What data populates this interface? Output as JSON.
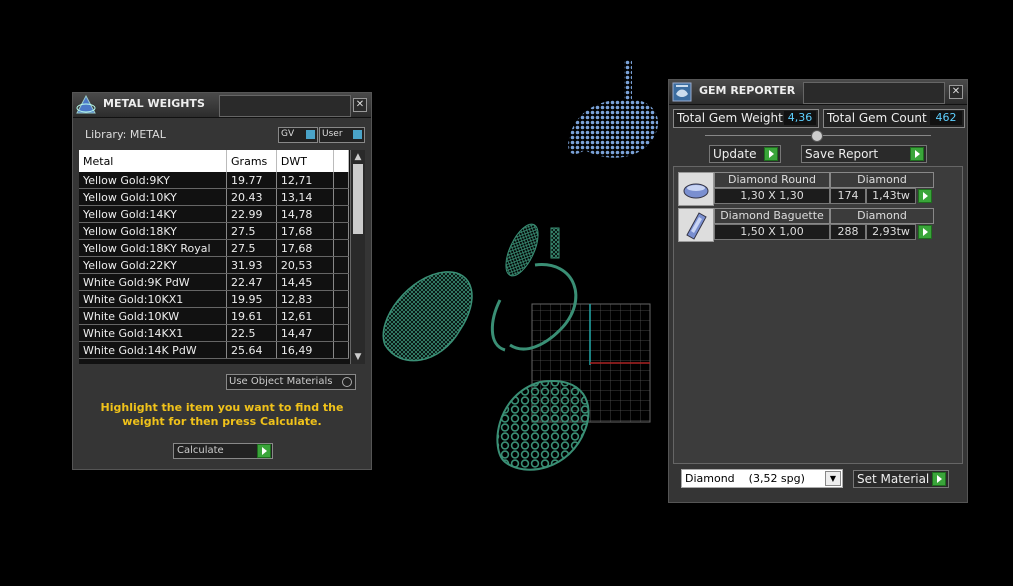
{
  "metal_weights": {
    "title": "METAL WEIGHTS",
    "library_label": "Library: METAL",
    "gv_label": "GV",
    "user_label": "User",
    "columns": [
      "Metal",
      "Grams",
      "DWT"
    ],
    "rows": [
      [
        "Yellow Gold:9KY",
        "19.77",
        "12,71"
      ],
      [
        "Yellow Gold:10KY",
        "20.43",
        "13,14"
      ],
      [
        "Yellow Gold:14KY",
        "22.99",
        "14,78"
      ],
      [
        "Yellow Gold:18KY",
        "27.5",
        "17,68"
      ],
      [
        "Yellow Gold:18KY Royal",
        "27.5",
        "17,68"
      ],
      [
        "Yellow Gold:22KY",
        "31.93",
        "20,53"
      ],
      [
        "White Gold:9K PdW",
        "22.47",
        "14,45"
      ],
      [
        "White Gold:10KX1",
        "19.95",
        "12,83"
      ],
      [
        "White Gold:10KW",
        "19.61",
        "12,61"
      ],
      [
        "White Gold:14KX1",
        "22.5",
        "14,47"
      ],
      [
        "White Gold:14K PdW",
        "25.64",
        "16,49"
      ]
    ],
    "use_object_materials": "Use Object Materials",
    "instruction": "Highlight the item you want to find the weight for then press Calculate.",
    "calculate_label": "Calculate"
  },
  "gem_reporter": {
    "title": "GEM REPORTER",
    "total_weight_label": "Total Gem Weight",
    "total_weight_value": "4,36",
    "total_count_label": "Total Gem Count",
    "total_count_value": "462",
    "update_label": "Update",
    "save_report_label": "Save Report",
    "gems": [
      {
        "name": "Diamond Round",
        "material": "Diamond",
        "size": "1,30 X 1,30",
        "count": "174",
        "weight": "1,43tw"
      },
      {
        "name": "Diamond Baguette",
        "material": "Diamond",
        "size": "1,50 X 1,00",
        "count": "288",
        "weight": "2,93tw"
      }
    ],
    "material_select": "Diamond    (3,52 spg)",
    "set_material_label": "Set Material"
  },
  "colors": {
    "green_mesh": "#3a8f75",
    "blue_mesh": "#7aa2d8",
    "accent_value": "#5ed0ff",
    "instruction_text": "#f0c21a"
  }
}
